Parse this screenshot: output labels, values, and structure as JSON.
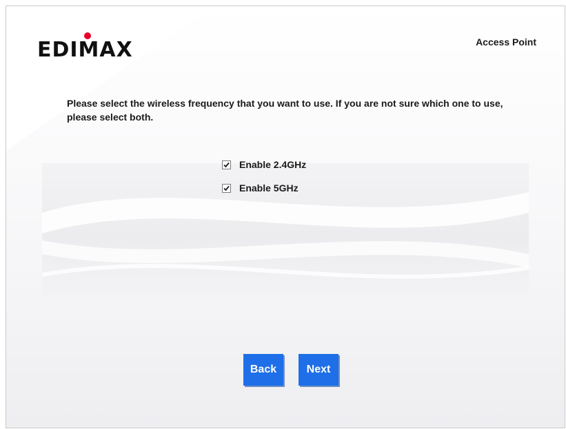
{
  "header": {
    "logo_text": "EDIMAX",
    "mode": "Access Point"
  },
  "main": {
    "instructions": "Please select the wireless frequency that you want to use. If you are not sure which one to use, please select both.",
    "options": [
      {
        "label": "Enable 2.4GHz",
        "checked": true
      },
      {
        "label": "Enable 5GHz",
        "checked": true
      }
    ]
  },
  "buttons": {
    "back": "Back",
    "next": "Next"
  },
  "colors": {
    "button": "#1e6fe8",
    "logo_dot": "#e8002a",
    "logo_text": "#111111"
  }
}
